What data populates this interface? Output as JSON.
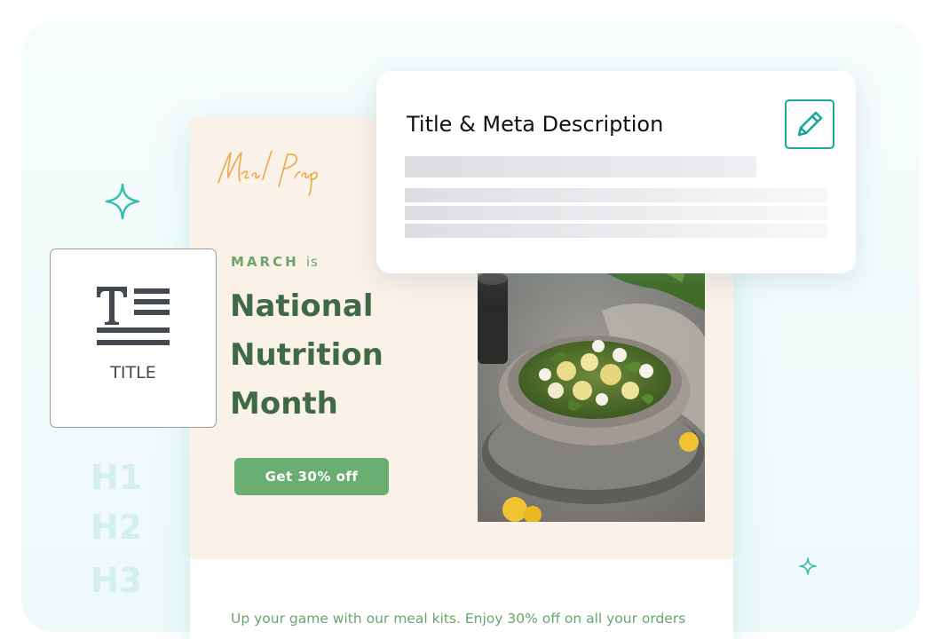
{
  "email": {
    "logo_text": "MealPrep",
    "kicker_strong": "MARCH",
    "kicker_rest": "is",
    "headline": [
      "National",
      "Nutrition",
      "Month"
    ],
    "cta_label": "Get 30% off",
    "tagline": "Up your game with our meal kits. Enjoy 30% off on all your orders"
  },
  "title_card": {
    "label": "TITLE"
  },
  "headings": [
    "H1",
    "H2",
    "H3"
  ],
  "meta_card": {
    "title": "Title & Meta Description"
  },
  "colors": {
    "accent_teal": "#19a99a",
    "brand_green": "#6aae72",
    "headline_green": "#3f6a45",
    "hero_bg": "#faf1e8",
    "logo_orange": "#eea64a"
  },
  "icons": [
    "sparkle-icon",
    "title-text-icon",
    "edit-pencil-icon"
  ]
}
